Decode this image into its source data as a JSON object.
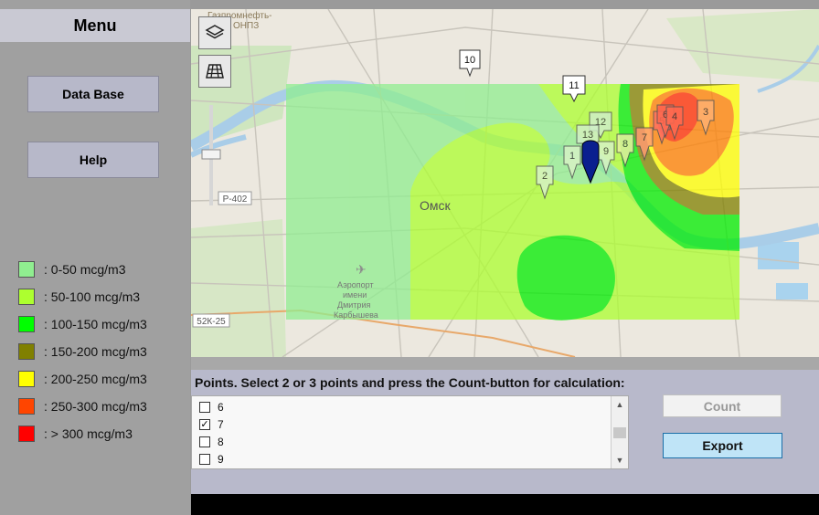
{
  "sidebar": {
    "title": "Menu",
    "buttons": {
      "database": "Data Base",
      "help": "Help"
    },
    "legend": [
      {
        "label": ": 0-50 mcg/m3",
        "color": "#90ee90"
      },
      {
        "label": ": 50-100 mcg/m3",
        "color": "#adff2f"
      },
      {
        "label": ": 100-150 mcg/m3",
        "color": "#00ff00"
      },
      {
        "label": ": 150-200 mcg/m3",
        "color": "#808000"
      },
      {
        "label": ": 200-250 mcg/m3",
        "color": "#ffff00"
      },
      {
        "label": ": 250-300 mcg/m3",
        "color": "#ff4500"
      },
      {
        "label": ": > 300 mcg/m3",
        "color": "#ff0000"
      }
    ]
  },
  "map": {
    "labels": {
      "city": "Омск",
      "refinery_1": "Газпромнефть-",
      "refinery_2": "ОНПЗ",
      "road_1": "Р-402",
      "road_2": "52К-25",
      "airport_1": "Аэропорт",
      "airport_2": "имени",
      "airport_3": "Дмитрия",
      "airport_4": "Карбышева"
    },
    "markers": [
      "10",
      "11",
      "12",
      "13",
      "1",
      "2",
      "9",
      "8",
      "7",
      "5",
      "6",
      "4",
      "3"
    ],
    "controls": {
      "layers": "layers-icon",
      "grid": "grid-icon"
    }
  },
  "points_panel": {
    "title": "Points. Select 2 or 3 points and press the Count-button for calculation:",
    "items": [
      {
        "label": "6",
        "checked": false
      },
      {
        "label": "7",
        "checked": true
      },
      {
        "label": "8",
        "checked": false
      },
      {
        "label": "9",
        "checked": false
      }
    ],
    "check_glyph": "✓",
    "count_button": "Count",
    "export_button": "Export"
  }
}
